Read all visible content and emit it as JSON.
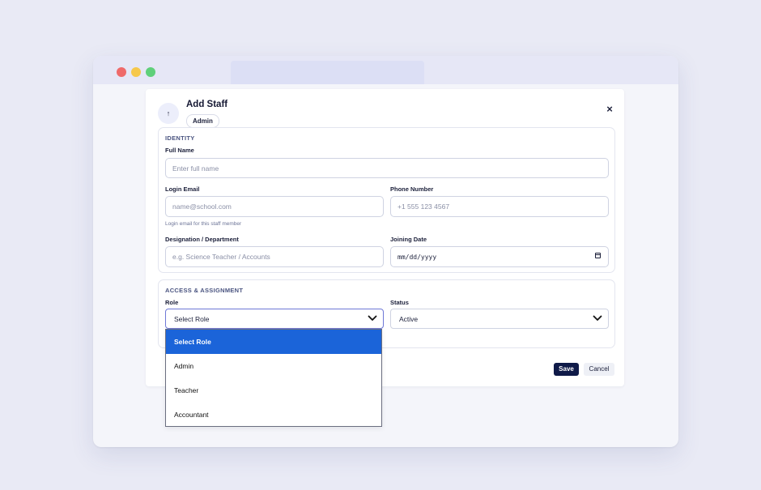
{
  "dialog": {
    "title": "Add Staff",
    "badge": "Admin",
    "close_label": "×",
    "header_icon": "up-arrow-icon"
  },
  "identity": {
    "section_title": "IDENTITY",
    "full_name": {
      "label": "Full Name",
      "placeholder": "Enter full name"
    },
    "login_email": {
      "label": "Login Email",
      "placeholder": "name@school.com",
      "hint": "Login email for this staff member"
    },
    "phone": {
      "label": "Phone Number",
      "placeholder": "+1 555 123 4567"
    },
    "designation": {
      "label": "Designation / Department",
      "placeholder": "e.g. Science Teacher / Accounts"
    },
    "joining_date": {
      "label": "Joining Date",
      "value": "mm/dd/yyyy"
    }
  },
  "access": {
    "section_title": "ACCESS & ASSIGNMENT",
    "role": {
      "label": "Role",
      "value": "Select Role"
    },
    "status": {
      "label": "Status",
      "value": "Active"
    }
  },
  "actions": {
    "save": "Save",
    "cancel": "Cancel"
  },
  "role_dropdown": {
    "options": [
      "Select Role",
      "Admin",
      "Teacher",
      "Accountant"
    ],
    "selected_index": 0
  },
  "colors": {
    "primary": "#0f1a48",
    "highlight": "#1b64d9",
    "background": "#e9eaf5"
  }
}
